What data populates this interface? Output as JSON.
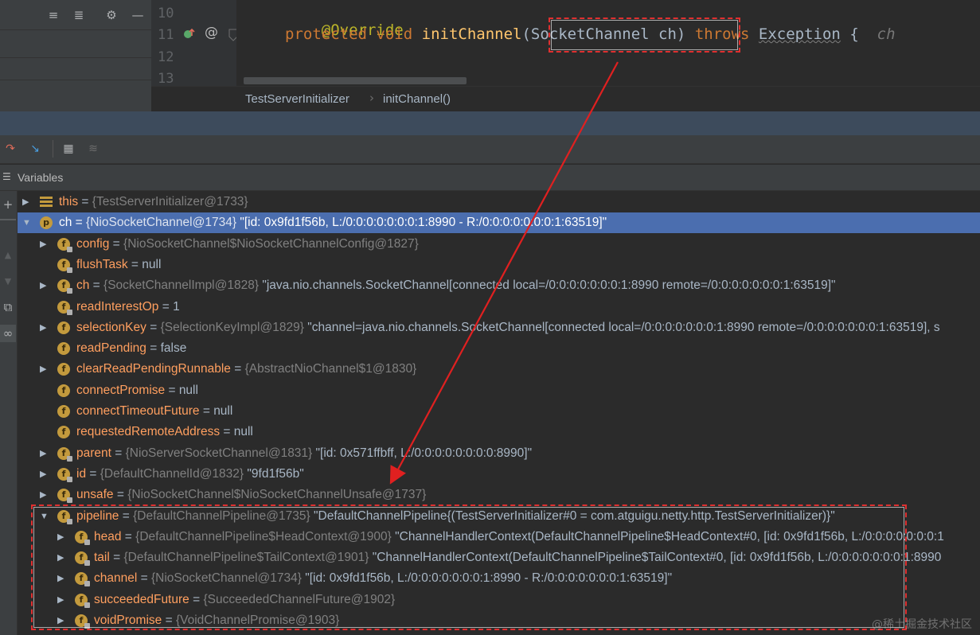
{
  "editor": {
    "line_numbers": [
      "10",
      "11",
      "12",
      "13"
    ],
    "line10": {
      "annotation": "@Override"
    },
    "line11": {
      "kw_protected": "protected",
      "kw_void": "void",
      "method": "initChannel",
      "params": "(SocketChannel ch)",
      "kw_throws": "throws",
      "exception": "Exception",
      "brace": "{",
      "param_hint": "ch"
    },
    "breadcrumb": [
      "TestServerInitializer",
      "initChannel()"
    ]
  },
  "toolbar_icons": [
    "expand-all-icon",
    "collapse-all-icon",
    "gear-icon",
    "minimize-icon"
  ],
  "debug_toolbar_icons": [
    "restore-layout-icon",
    "jump-to-cursor-icon",
    "table-view-icon",
    "columns-icon"
  ],
  "variables_panel": {
    "title": "Variables",
    "side_icons": [
      "plus-icon",
      "up-icon",
      "down-icon",
      "copy-icon",
      "watches-icon"
    ],
    "rows": [
      {
        "indent": 0,
        "expandable": true,
        "expanded": false,
        "icon": "this",
        "name": "this",
        "type": "{TestServerInitializer@1733}",
        "value": ""
      },
      {
        "indent": 0,
        "expandable": true,
        "expanded": true,
        "icon": "p",
        "name": "ch",
        "type": "{NioSocketChannel@1734}",
        "value": "\"[id: 0x9fd1f56b, L:/0:0:0:0:0:0:0:1:8990 - R:/0:0:0:0:0:0:0:1:63519]\"",
        "selected": true
      },
      {
        "indent": 1,
        "expandable": true,
        "expanded": false,
        "icon": "f-lock",
        "name": "config",
        "type": "{NioSocketChannel$NioSocketChannelConfig@1827}",
        "value": ""
      },
      {
        "indent": 1,
        "expandable": false,
        "icon": "f-lock",
        "name": "flushTask",
        "type": "",
        "value": "null"
      },
      {
        "indent": 1,
        "expandable": true,
        "expanded": false,
        "icon": "f-lock",
        "name": "ch",
        "type": "{SocketChannelImpl@1828}",
        "value": "\"java.nio.channels.SocketChannel[connected local=/0:0:0:0:0:0:0:1:8990 remote=/0:0:0:0:0:0:0:1:63519]\""
      },
      {
        "indent": 1,
        "expandable": false,
        "icon": "f-lock",
        "name": "readInterestOp",
        "type": "",
        "value": "1"
      },
      {
        "indent": 1,
        "expandable": true,
        "expanded": false,
        "icon": "f",
        "name": "selectionKey",
        "type": "{SelectionKeyImpl@1829}",
        "value": "\"channel=java.nio.channels.SocketChannel[connected local=/0:0:0:0:0:0:0:1:8990 remote=/0:0:0:0:0:0:0:1:63519], s"
      },
      {
        "indent": 1,
        "expandable": false,
        "icon": "f",
        "name": "readPending",
        "type": "",
        "value": "false"
      },
      {
        "indent": 1,
        "expandable": true,
        "expanded": false,
        "icon": "f",
        "name": "clearReadPendingRunnable",
        "type": "{AbstractNioChannel$1@1830}",
        "value": ""
      },
      {
        "indent": 1,
        "expandable": false,
        "icon": "f",
        "name": "connectPromise",
        "type": "",
        "value": "null"
      },
      {
        "indent": 1,
        "expandable": false,
        "icon": "f",
        "name": "connectTimeoutFuture",
        "type": "",
        "value": "null"
      },
      {
        "indent": 1,
        "expandable": false,
        "icon": "f",
        "name": "requestedRemoteAddress",
        "type": "",
        "value": "null"
      },
      {
        "indent": 1,
        "expandable": true,
        "expanded": false,
        "icon": "f-lock",
        "name": "parent",
        "type": "{NioServerSocketChannel@1831}",
        "value": "\"[id: 0x571ffbff, L:/0:0:0:0:0:0:0:0:8990]\""
      },
      {
        "indent": 1,
        "expandable": true,
        "expanded": false,
        "icon": "f-lock",
        "name": "id",
        "type": "{DefaultChannelId@1832}",
        "value": "\"9fd1f56b\""
      },
      {
        "indent": 1,
        "expandable": true,
        "expanded": false,
        "icon": "f-lock",
        "name": "unsafe",
        "type": "{NioSocketChannel$NioSocketChannelUnsafe@1737}",
        "value": ""
      },
      {
        "indent": 1,
        "expandable": true,
        "expanded": true,
        "icon": "f-lock",
        "name": "pipeline",
        "type": "{DefaultChannelPipeline@1735}",
        "value": "\"DefaultChannelPipeline{(TestServerInitializer#0 = com.atguigu.netty.http.TestServerInitializer)}\""
      },
      {
        "indent": 2,
        "expandable": true,
        "expanded": false,
        "icon": "f-lock",
        "name": "head",
        "type": "{DefaultChannelPipeline$HeadContext@1900}",
        "value": "\"ChannelHandlerContext(DefaultChannelPipeline$HeadContext#0, [id: 0x9fd1f56b, L:/0:0:0:0:0:0:0:1"
      },
      {
        "indent": 2,
        "expandable": true,
        "expanded": false,
        "icon": "f-lock",
        "name": "tail",
        "type": "{DefaultChannelPipeline$TailContext@1901}",
        "value": "\"ChannelHandlerContext(DefaultChannelPipeline$TailContext#0, [id: 0x9fd1f56b, L:/0:0:0:0:0:0:0:1:8990"
      },
      {
        "indent": 2,
        "expandable": true,
        "expanded": false,
        "icon": "f-lock",
        "name": "channel",
        "type": "{NioSocketChannel@1734}",
        "value": "\"[id: 0x9fd1f56b, L:/0:0:0:0:0:0:0:1:8990 - R:/0:0:0:0:0:0:0:1:63519]\""
      },
      {
        "indent": 2,
        "expandable": true,
        "expanded": false,
        "icon": "f-lock",
        "name": "succeededFuture",
        "type": "{SucceededChannelFuture@1902}",
        "value": ""
      },
      {
        "indent": 2,
        "expandable": true,
        "expanded": false,
        "icon": "f-lock",
        "name": "voidPromise",
        "type": "{VoidChannelPromise@1903}",
        "value": ""
      }
    ]
  },
  "watermark": "@稀土掘金技术社区",
  "colors": {
    "annotation_red": "#e03030",
    "selection_blue": "#4b6eaf",
    "field_badge": "#c39a3d"
  }
}
